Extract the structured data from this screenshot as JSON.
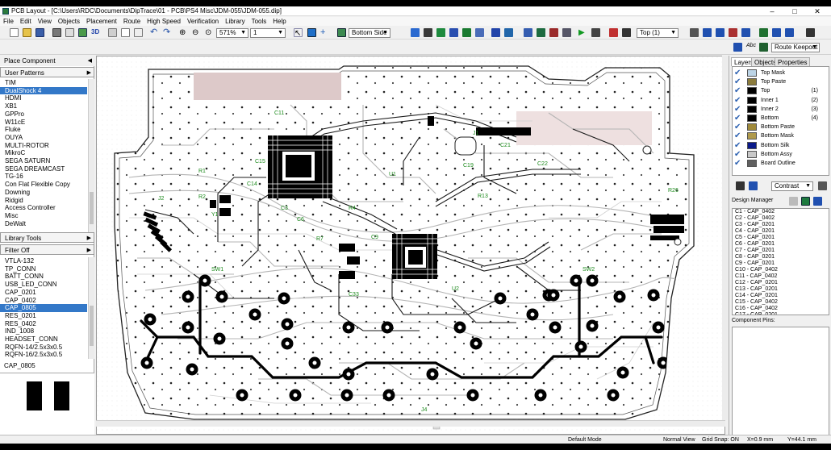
{
  "window": {
    "title": "PCB Layout - [C:\\Users\\RDC\\Documents\\DipTrace\\01 - PCB\\PS4 Misc\\JDM-055\\JDM-055.dip]"
  },
  "window_controls": {
    "minimize": "–",
    "maximize": "□",
    "close": "✕"
  },
  "menu": [
    "File",
    "Edit",
    "View",
    "Objects",
    "Placement",
    "Route",
    "High Speed",
    "Verification",
    "Library",
    "Tools",
    "Help"
  ],
  "toolbar": {
    "zoom": "571%",
    "width": "1",
    "side": "Bottom Side",
    "layer": "Top (1)",
    "route_mode": "Route Keepout",
    "three_d": "3D",
    "abc": "Abc"
  },
  "left_panel": {
    "title": "Place Component",
    "user_patterns": "User Patterns",
    "patterns": [
      "TIM",
      "DualShock 4",
      "HDMI",
      "XB1",
      "GPPro",
      "W11cE",
      "Fluke",
      "OUYA",
      "MULTI-ROTOR",
      "MikroC",
      "SEGA SATURN",
      "SEGA DREAMCAST",
      "TG-16",
      "Con Flat Flexible Copy",
      "Downing",
      "Ridgid",
      "Access Controller",
      "Misc",
      "DeWalt"
    ],
    "patterns_selected": 1,
    "library_tools": "Library Tools",
    "filter": "Filter Off",
    "components": [
      "VTLA-132",
      "TP_CONN",
      "BATT_CONN",
      "USB_LED_CONN",
      "CAP_0201",
      "CAP_0402",
      "CAP_0805",
      "RES_0201",
      "RES_0402",
      "IND_1008",
      "HEADSET_CONN",
      "RQFN-14/2.5x3x0.5",
      "RQFN-16/2.5x3x0.5"
    ],
    "components_selected": 6,
    "preview_name": "CAP_0805"
  },
  "right_panel": {
    "tabs": [
      "Layers",
      "Objects",
      "Properties"
    ],
    "active_tab": 0,
    "layers": [
      {
        "name": "Top Mask",
        "color": "#bcd4e6",
        "num": ""
      },
      {
        "name": "Top Paste",
        "color": "#8c7c3c",
        "num": ""
      },
      {
        "name": "Top",
        "color": "#000000",
        "num": "(1)"
      },
      {
        "name": "Inner 1",
        "color": "#000000",
        "num": "(2)"
      },
      {
        "name": "Inner 2",
        "color": "#000000",
        "num": "(3)"
      },
      {
        "name": "Bottom",
        "color": "#000000",
        "num": "(4)"
      },
      {
        "name": "Bottom Paste",
        "color": "#a08a3a",
        "num": ""
      },
      {
        "name": "Bottom Mask",
        "color": "#b09a4c",
        "num": ""
      },
      {
        "name": "Bottom Silk",
        "color": "#0a1a8a",
        "num": ""
      },
      {
        "name": "Bottom Assy",
        "color": "#c8c8c8",
        "num": ""
      },
      {
        "name": "Board Outline",
        "color": "#606060",
        "num": ""
      }
    ],
    "contrast": "Contrast",
    "design_manager_title": "Design Manager",
    "design_manager": [
      "C1 - CAP_0402",
      "C2 - CAP_0402",
      "C3 - CAP_0201",
      "C4 - CAP_0201",
      "C5 - CAP_0201",
      "C6 - CAP_0201",
      "C7 - CAP_0201",
      "C8 - CAP_0201",
      "C9 - CAP_0201",
      "C10 - CAP_0402",
      "C11 - CAP_0402",
      "C12 - CAP_0201",
      "C13 - CAP_0201",
      "C14 - CAP_0201",
      "C15 - CAP_0402",
      "C16 - CAP_0402",
      "C17 - CAP_0201"
    ],
    "component_pins_title": "Component Pins:"
  },
  "pcb_labels": [
    "C11",
    "J1",
    "C22",
    "C19",
    "R13",
    "R26",
    "SW1",
    "SW2",
    "J2",
    "J4",
    "C33",
    "R1",
    "R2",
    "Y1",
    "C3",
    "C6",
    "U1",
    "U2",
    "C21",
    "C9",
    "R4",
    "R7",
    "C14",
    "C15"
  ],
  "status": {
    "mode": "Default Mode",
    "view": "Normal View",
    "grid": "Grid Snap: ON",
    "x": "X=0.9 mm",
    "y": "Y=44.1 mm"
  }
}
